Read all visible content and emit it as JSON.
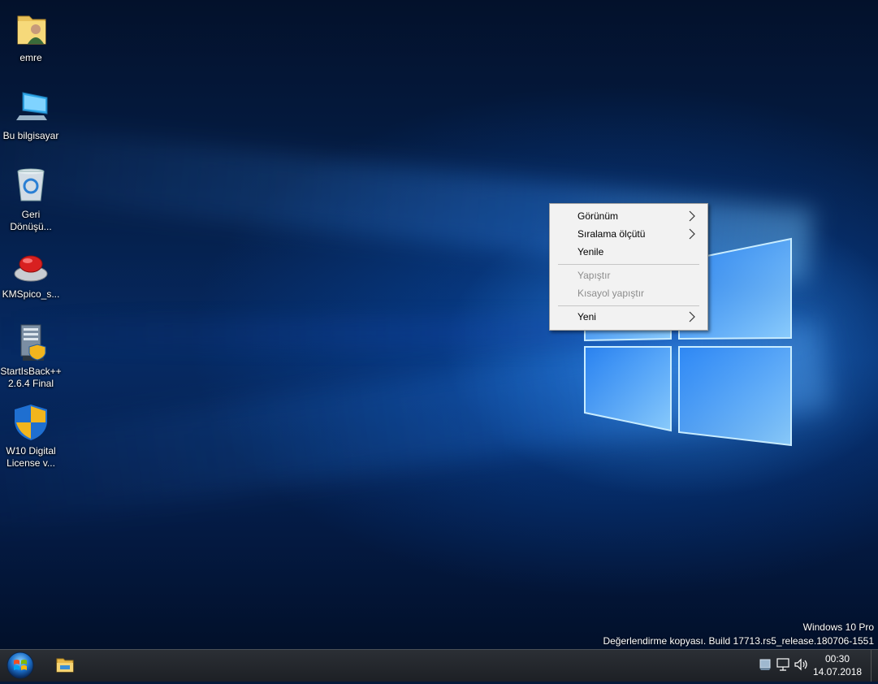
{
  "desktop_icons": [
    {
      "label": "emre",
      "icon": "user-folder-icon"
    },
    {
      "label": "Bu bilgisayar",
      "icon": "computer-icon"
    },
    {
      "label": "Geri Dönüşü...",
      "icon": "recycle-bin-icon"
    },
    {
      "label": "KMSpico_s...",
      "icon": "red-button-icon"
    },
    {
      "label": "StartIsBack++ 2.6.4 Final",
      "icon": "installer-icon"
    },
    {
      "label": "W10 Digital License v...",
      "icon": "shield-icon"
    }
  ],
  "context_menu": {
    "items": [
      {
        "label": "Görünüm",
        "submenu": true,
        "disabled": false
      },
      {
        "label": "Sıralama ölçütü",
        "submenu": true,
        "disabled": false
      },
      {
        "label": "Yenile",
        "submenu": false,
        "disabled": false
      },
      {
        "label": "Yapıştır",
        "submenu": false,
        "disabled": true
      },
      {
        "label": "Kısayol yapıştır",
        "submenu": false,
        "disabled": true
      },
      {
        "label": "Yeni",
        "submenu": true,
        "disabled": false
      }
    ]
  },
  "watermark": {
    "line1": "Windows 10 Pro",
    "line2": "Değerlendirme kopyası. Build 17713.rs5_release.180706-1551"
  },
  "taskbar": {
    "start_icon": "windows-orb-icon",
    "pinned": [
      "file-explorer-icon"
    ],
    "tray_icons": [
      "network-share-icon",
      "network-icon",
      "volume-icon"
    ],
    "time": "00:30",
    "date": "14.07.2018"
  },
  "colors": {
    "desktop_bg": "#062a63",
    "menu_bg": "#f2f2f2",
    "taskbar_bg": "#1d2025"
  }
}
